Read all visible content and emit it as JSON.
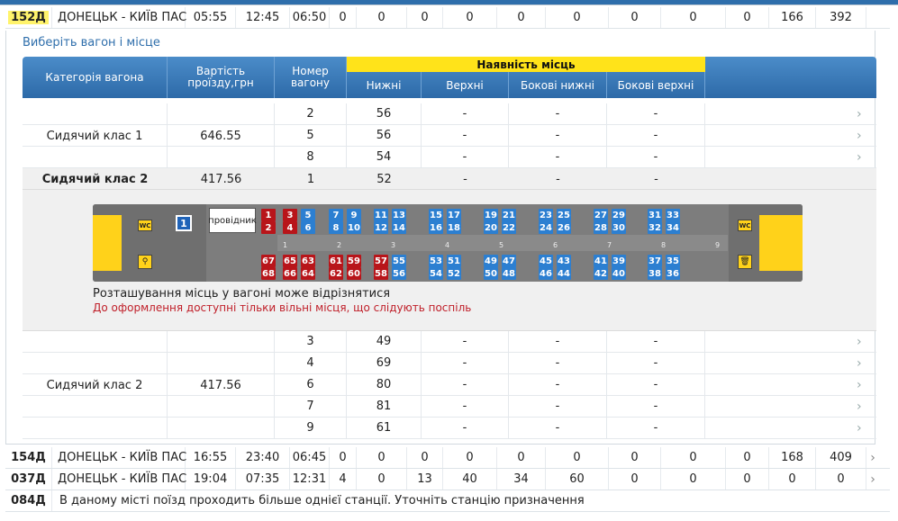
{
  "trains": [
    {
      "num": "152Д",
      "route": "ДОНЕЦЬК - КИЇВ ПАС",
      "dep": "05:55",
      "arr": "12:45",
      "dur": "06:50",
      "vals": [
        "0",
        "0",
        "0",
        "0",
        "0",
        "0",
        "0",
        "0",
        "0",
        "166",
        "392"
      ]
    },
    {
      "num": "154Д",
      "route": "ДОНЕЦЬК - КИЇВ ПАС",
      "dep": "16:55",
      "arr": "23:40",
      "dur": "06:45",
      "vals": [
        "0",
        "0",
        "0",
        "0",
        "0",
        "0",
        "0",
        "0",
        "0",
        "168",
        "409"
      ]
    },
    {
      "num": "037Д",
      "route": "ДОНЕЦЬК - КИЇВ ПАС",
      "dep": "19:04",
      "arr": "07:35",
      "dur": "12:31",
      "vals": [
        "4",
        "0",
        "13",
        "40",
        "34",
        "60",
        "0",
        "0",
        "0",
        "0",
        "0"
      ]
    },
    {
      "num": "084Д",
      "message": "В даному місті поїзд проходить більше однієї станції. Уточніть станцію призначення"
    }
  ],
  "choose_link": "Виберіть вагон і місце",
  "table": {
    "headers": {
      "category": "Категорія вагона",
      "price": "Вартість проїзду,грн",
      "wagon": "Номер вагону",
      "availability": "Наявність місць",
      "lower": "Нижні",
      "upper": "Верхні",
      "side_lower": "Бокові нижні",
      "side_upper": "Бокові верхні"
    },
    "group1": {
      "label": "Сидячий клас 1",
      "price": "646.55",
      "rows": [
        {
          "wagon": "2",
          "lower": "56",
          "upper": "-",
          "side_lower": "-",
          "side_upper": "-"
        },
        {
          "wagon": "5",
          "lower": "56",
          "upper": "-",
          "side_lower": "-",
          "side_upper": "-"
        },
        {
          "wagon": "8",
          "lower": "54",
          "upper": "-",
          "side_lower": "-",
          "side_upper": "-"
        }
      ]
    },
    "selected": {
      "label": "Сидячий клас 2",
      "price": "417.56",
      "wagon": "1",
      "lower": "52",
      "upper": "-",
      "side_lower": "-",
      "side_upper": "-"
    },
    "group2": {
      "label": "Сидячий клас 2",
      "price": "417.56",
      "rows": [
        {
          "wagon": "3",
          "lower": "49",
          "upper": "-",
          "side_lower": "-",
          "side_upper": "-"
        },
        {
          "wagon": "4",
          "lower": "69",
          "upper": "-",
          "side_lower": "-",
          "side_upper": "-"
        },
        {
          "wagon": "6",
          "lower": "80",
          "upper": "-",
          "side_lower": "-",
          "side_upper": "-"
        },
        {
          "wagon": "7",
          "lower": "81",
          "upper": "-",
          "side_lower": "-",
          "side_upper": "-"
        },
        {
          "wagon": "9",
          "lower": "61",
          "upper": "-",
          "side_lower": "-",
          "side_upper": "-"
        }
      ]
    }
  },
  "scheme": {
    "car_number": "1",
    "conductor": "провідник",
    "wc": "WC",
    "top_seats": [
      [
        "1",
        "2"
      ],
      [
        "3",
        "4"
      ],
      [
        "5",
        "6"
      ],
      [
        "7",
        "8"
      ],
      [
        "9",
        "10"
      ],
      [
        "11",
        "12"
      ],
      [
        "13",
        "14"
      ],
      [
        "15",
        "16"
      ],
      [
        "17",
        "18"
      ],
      [
        "19",
        "20"
      ],
      [
        "21",
        "22"
      ],
      [
        "23",
        "24"
      ],
      [
        "25",
        "26"
      ],
      [
        "27",
        "28"
      ],
      [
        "29",
        "30"
      ],
      [
        "31",
        "32"
      ],
      [
        "33",
        "34"
      ]
    ],
    "bottom_seats": [
      [
        "67",
        "68"
      ],
      [
        "65",
        "66"
      ],
      [
        "63",
        "64"
      ],
      [
        "61",
        "62"
      ],
      [
        "59",
        "60"
      ],
      [
        "57",
        "58"
      ],
      [
        "55",
        "56"
      ],
      [
        "53",
        "54"
      ],
      [
        "51",
        "52"
      ],
      [
        "49",
        "50"
      ],
      [
        "47",
        "48"
      ],
      [
        "45",
        "46"
      ],
      [
        "43",
        "44"
      ],
      [
        "41",
        "42"
      ],
      [
        "39",
        "40"
      ],
      [
        "37",
        "38"
      ],
      [
        "35",
        "36"
      ]
    ],
    "taken": [
      "1",
      "2",
      "3",
      "4",
      "57",
      "58",
      "59",
      "60",
      "61",
      "62",
      "63",
      "64",
      "65",
      "66",
      "67",
      "68"
    ],
    "compartments": [
      "1",
      "2",
      "3",
      "4",
      "5",
      "6",
      "7",
      "8",
      "9"
    ],
    "note": "Розташування місць у вагоні може відрізнятися",
    "warning": "До оформлення доступні тільки вільні місця, що слідують поспіль"
  },
  "chevron": "›"
}
